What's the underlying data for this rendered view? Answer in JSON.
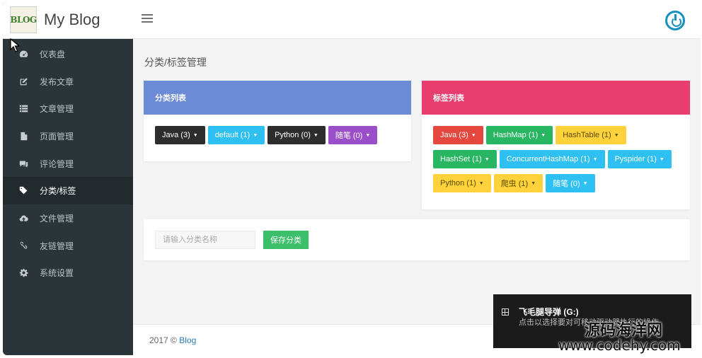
{
  "brand": {
    "logo_text": "BLOG",
    "name": "My Blog"
  },
  "sidebar": {
    "items": [
      {
        "label": "仪表盘",
        "icon": "dashboard-icon",
        "active": false
      },
      {
        "label": "发布文章",
        "icon": "edit-icon",
        "active": false
      },
      {
        "label": "文章管理",
        "icon": "list-icon",
        "active": false
      },
      {
        "label": "页面管理",
        "icon": "file-icon",
        "active": false
      },
      {
        "label": "评论管理",
        "icon": "comments-icon",
        "active": false
      },
      {
        "label": "分类/标签",
        "icon": "tags-icon",
        "active": true
      },
      {
        "label": "文件管理",
        "icon": "cloud-upload-icon",
        "active": false
      },
      {
        "label": "友链管理",
        "icon": "link-icon",
        "active": false
      },
      {
        "label": "系统设置",
        "icon": "gear-icon",
        "active": false
      }
    ]
  },
  "header": {
    "menu_icon": "hamburger-icon",
    "power_icon": "power-icon"
  },
  "main": {
    "page_title": "分类/标签管理",
    "category_panel": {
      "title": "分类列表",
      "items": [
        {
          "label": "Java (3)",
          "color": "#2d2d2d"
        },
        {
          "label": "default (1)",
          "color": "#2ec0f2"
        },
        {
          "label": "Python (0)",
          "color": "#2d2d2d"
        },
        {
          "label": "随笔 (0)",
          "color": "#9a4fc8"
        }
      ]
    },
    "tag_panel": {
      "title": "标签列表",
      "items": [
        {
          "label": "Java (3)",
          "color": "#e5473e"
        },
        {
          "label": "HashMap (1)",
          "color": "#28b662"
        },
        {
          "label": "HashTable (1)",
          "color": "#ffd13a"
        },
        {
          "label": "HashSet (1)",
          "color": "#28b662"
        },
        {
          "label": "ConcurrentHashMap (1)",
          "color": "#2ec0f2"
        },
        {
          "label": "Pyspider (1)",
          "color": "#2ec0f2"
        },
        {
          "label": "Python (1)",
          "color": "#ffd13a"
        },
        {
          "label": "爬虫 (1)",
          "color": "#ffd13a"
        },
        {
          "label": "随笔 (0)",
          "color": "#2ec0f2"
        }
      ]
    },
    "form": {
      "input_placeholder": "请输入分类名称",
      "save_label": "保存分类"
    }
  },
  "footer": {
    "text": "2017 © ",
    "link": "Blog"
  },
  "toast": {
    "title": "飞毛腿导弹 (G:)",
    "body": "点击以选择要对可移动驱动器执行的操作。"
  },
  "watermark": {
    "cn": "源码海洋网",
    "url": "www.codehy.com"
  }
}
